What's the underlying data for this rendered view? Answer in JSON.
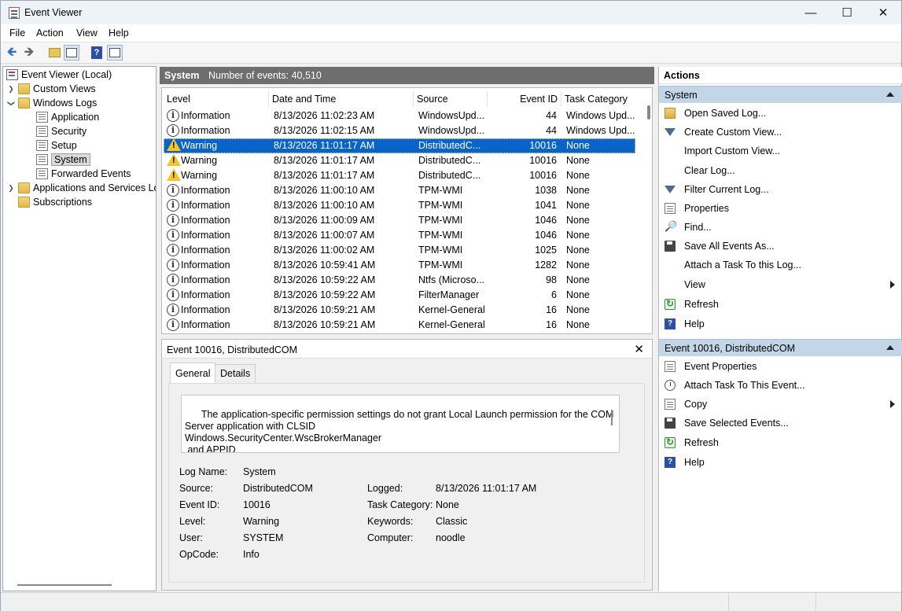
{
  "window": {
    "title": "Event Viewer"
  },
  "menu": [
    "File",
    "Action",
    "View",
    "Help"
  ],
  "tree": {
    "root": "Event Viewer (Local)",
    "items": [
      {
        "label": "Custom Views",
        "level": 1,
        "chev": ">",
        "icon": "folder"
      },
      {
        "label": "Windows Logs",
        "level": 1,
        "chev": "v",
        "icon": "folder"
      },
      {
        "label": "Application",
        "level": 2,
        "icon": "log"
      },
      {
        "label": "Security",
        "level": 2,
        "icon": "log"
      },
      {
        "label": "Setup",
        "level": 2,
        "icon": "log"
      },
      {
        "label": "System",
        "level": 2,
        "icon": "log",
        "selected": true
      },
      {
        "label": "Forwarded Events",
        "level": 2,
        "icon": "log"
      },
      {
        "label": "Applications and Services Lo",
        "level": 1,
        "chev": ">",
        "icon": "folder"
      },
      {
        "label": "Subscriptions",
        "level": 1,
        "icon": "folder"
      }
    ]
  },
  "center": {
    "log_name": "System",
    "count_text": "Number of events: 40,510",
    "columns": [
      "Level",
      "Date and Time",
      "Source",
      "Event ID",
      "Task Category"
    ],
    "rows": [
      {
        "level": "Information",
        "date": "8/13/2026 11:02:23 AM",
        "source": "WindowsUpd...",
        "id": "44",
        "task": "Windows Upd..."
      },
      {
        "level": "Information",
        "date": "8/13/2026 11:02:15 AM",
        "source": "WindowsUpd...",
        "id": "44",
        "task": "Windows Upd..."
      },
      {
        "level": "Warning",
        "date": "8/13/2026 11:01:17 AM",
        "source": "DistributedC...",
        "id": "10016",
        "task": "None",
        "selected": true
      },
      {
        "level": "Warning",
        "date": "8/13/2026 11:01:17 AM",
        "source": "DistributedC...",
        "id": "10016",
        "task": "None"
      },
      {
        "level": "Warning",
        "date": "8/13/2026 11:01:17 AM",
        "source": "DistributedC...",
        "id": "10016",
        "task": "None"
      },
      {
        "level": "Information",
        "date": "8/13/2026 11:00:10 AM",
        "source": "TPM-WMI",
        "id": "1038",
        "task": "None"
      },
      {
        "level": "Information",
        "date": "8/13/2026 11:00:10 AM",
        "source": "TPM-WMI",
        "id": "1041",
        "task": "None"
      },
      {
        "level": "Information",
        "date": "8/13/2026 11:00:09 AM",
        "source": "TPM-WMI",
        "id": "1046",
        "task": "None"
      },
      {
        "level": "Information",
        "date": "8/13/2026 11:00:07 AM",
        "source": "TPM-WMI",
        "id": "1046",
        "task": "None"
      },
      {
        "level": "Information",
        "date": "8/13/2026 11:00:02 AM",
        "source": "TPM-WMI",
        "id": "1025",
        "task": "None"
      },
      {
        "level": "Information",
        "date": "8/13/2026 10:59:41 AM",
        "source": "TPM-WMI",
        "id": "1282",
        "task": "None"
      },
      {
        "level": "Information",
        "date": "8/13/2026 10:59:22 AM",
        "source": "Ntfs (Microso...",
        "id": "98",
        "task": "None"
      },
      {
        "level": "Information",
        "date": "8/13/2026 10:59:22 AM",
        "source": "FilterManager",
        "id": "6",
        "task": "None"
      },
      {
        "level": "Information",
        "date": "8/13/2026 10:59:21 AM",
        "source": "Kernel-General",
        "id": "16",
        "task": "None"
      },
      {
        "level": "Information",
        "date": "8/13/2026 10:59:21 AM",
        "source": "Kernel-General",
        "id": "16",
        "task": "None"
      }
    ]
  },
  "detail": {
    "title": "Event 10016, DistributedCOM",
    "tabs": [
      "General",
      "Details"
    ],
    "description": "The application-specific permission settings do not grant Local Launch permission for the COM\nServer application with CLSID \nWindows.SecurityCenter.WscBrokerManager\n and APPID \nUnavailable",
    "fields": {
      "log_name_label": "Log Name:",
      "log_name": "System",
      "source_label": "Source:",
      "source": "DistributedCOM",
      "logged_label": "Logged:",
      "logged": "8/13/2026 11:01:17 AM",
      "event_id_label": "Event ID:",
      "event_id": "10016",
      "task_category_label": "Task Category:",
      "task_category": "None",
      "level_label": "Level:",
      "level": "Warning",
      "keywords_label": "Keywords:",
      "keywords": "Classic",
      "user_label": "User:",
      "user": "SYSTEM",
      "computer_label": "Computer:",
      "computer": "noodle",
      "opcode_label": "OpCode:",
      "opcode": "Info"
    }
  },
  "actions": {
    "title": "Actions",
    "section1": "System",
    "items1": [
      {
        "label": "Open Saved Log...",
        "icon": "folder-open-icon"
      },
      {
        "label": "Create Custom View...",
        "icon": "filter-icon"
      },
      {
        "label": "Import Custom View...",
        "icon": ""
      },
      {
        "label": "Clear Log...",
        "icon": ""
      },
      {
        "label": "Filter Current Log...",
        "icon": "filter-icon"
      },
      {
        "label": "Properties",
        "icon": "properties-icon"
      },
      {
        "label": "Find...",
        "icon": "find-icon"
      },
      {
        "label": "Save All Events As...",
        "icon": "save-icon"
      },
      {
        "label": "Attach a Task To this Log...",
        "icon": ""
      },
      {
        "label": "View",
        "icon": "",
        "submenu": true
      },
      {
        "label": "Refresh",
        "icon": "refresh-icon"
      },
      {
        "label": "Help",
        "icon": "help-icon"
      }
    ],
    "section2": "Event 10016, DistributedCOM",
    "items2": [
      {
        "label": "Event Properties",
        "icon": "properties-icon"
      },
      {
        "label": "Attach Task To This Event...",
        "icon": "task-icon"
      },
      {
        "label": "Copy",
        "icon": "copy-icon",
        "submenu": true
      },
      {
        "label": "Save Selected Events...",
        "icon": "save-icon"
      },
      {
        "label": "Refresh",
        "icon": "refresh-icon"
      },
      {
        "label": "Help",
        "icon": "help-icon"
      }
    ]
  }
}
